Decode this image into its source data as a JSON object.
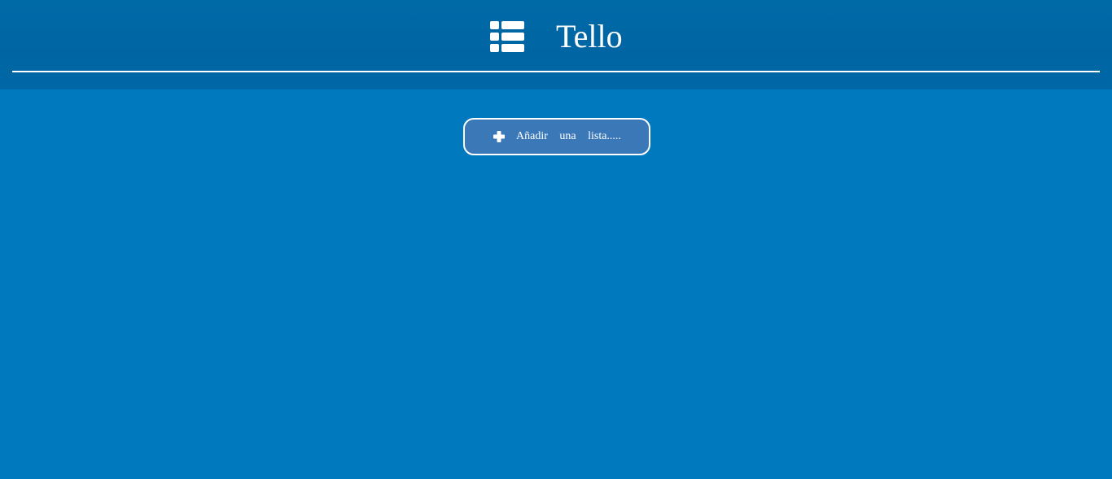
{
  "header": {
    "logo_icon": "list-icon",
    "title": "Tello"
  },
  "main": {
    "add_list": {
      "icon": "plus-icon",
      "label": "Añadir una lista....."
    }
  },
  "colors": {
    "background": "#0079bf",
    "header_background": "#0067a5",
    "button_background": "#3b78b8",
    "text": "#ffffff"
  }
}
